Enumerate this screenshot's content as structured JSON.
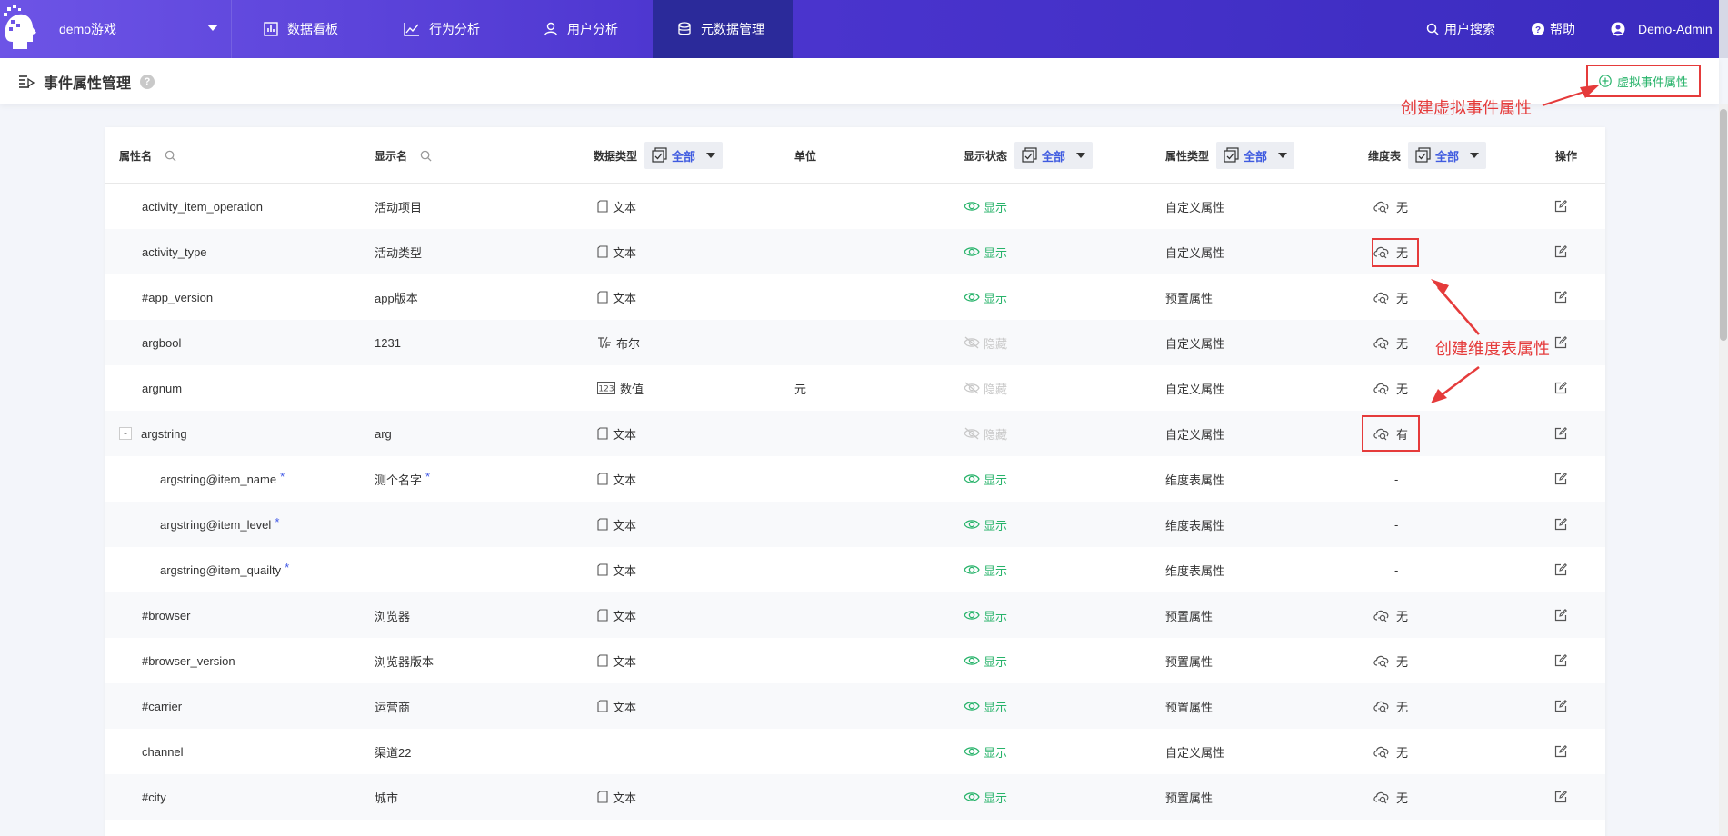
{
  "nav": {
    "game": "demo游戏",
    "items": [
      {
        "label": "数据看板",
        "icon": "bar-chart-icon"
      },
      {
        "label": "行为分析",
        "icon": "line-chart-icon"
      },
      {
        "label": "用户分析",
        "icon": "user-icon"
      },
      {
        "label": "元数据管理",
        "icon": "database-icon",
        "active": true
      }
    ],
    "user_search": "用户搜索",
    "help": "帮助",
    "account": "Demo-Admin"
  },
  "header": {
    "title": "事件属性管理",
    "help_mark": "?",
    "virtual_button": "虚拟事件属性"
  },
  "annotations": {
    "virtual": "创建虚拟事件属性",
    "dimension": "创建维度表属性"
  },
  "table": {
    "columns": {
      "name": "属性名",
      "display": "显示名",
      "data_type": "数据类型",
      "unit": "单位",
      "status": "显示状态",
      "attr_type": "属性类型",
      "dim": "维度表",
      "action": "操作",
      "filter_all": "全部"
    },
    "rows": [
      {
        "name": "activity_item_operation",
        "display": "活动项目",
        "type": "文本",
        "type_icon": "text",
        "unit": "",
        "status": "显示",
        "shown": true,
        "attr": "自定义属性",
        "dim": "无"
      },
      {
        "name": "activity_type",
        "display": "活动类型",
        "type": "文本",
        "type_icon": "text",
        "unit": "",
        "status": "显示",
        "shown": true,
        "attr": "自定义属性",
        "dim": "无"
      },
      {
        "name": "#app_version",
        "display": "app版本",
        "type": "文本",
        "type_icon": "text",
        "unit": "",
        "status": "显示",
        "shown": true,
        "attr": "预置属性",
        "dim": "无"
      },
      {
        "name": "argbool",
        "display": "1231",
        "type": "布尔",
        "type_icon": "bool",
        "unit": "",
        "status": "隐藏",
        "shown": false,
        "attr": "自定义属性",
        "dim": "无"
      },
      {
        "name": "argnum",
        "display": "",
        "type": "数值",
        "type_icon": "number",
        "unit": "元",
        "status": "隐藏",
        "shown": false,
        "attr": "自定义属性",
        "dim": "无"
      },
      {
        "name": "argstring",
        "display": "arg",
        "type": "文本",
        "type_icon": "text",
        "unit": "",
        "status": "隐藏",
        "shown": false,
        "attr": "自定义属性",
        "dim": "有",
        "expand": "-"
      },
      {
        "name": "argstring@item_name",
        "display": "测个名字",
        "type": "文本",
        "type_icon": "text",
        "unit": "",
        "status": "显示",
        "shown": true,
        "attr": "维度表属性",
        "dim": "-",
        "child": true,
        "req": "*",
        "display_req": "*"
      },
      {
        "name": "argstring@item_level",
        "display": "",
        "type": "文本",
        "type_icon": "text",
        "unit": "",
        "status": "显示",
        "shown": true,
        "attr": "维度表属性",
        "dim": "-",
        "child": true,
        "req": "*"
      },
      {
        "name": "argstring@item_quailty",
        "display": "",
        "type": "文本",
        "type_icon": "text",
        "unit": "",
        "status": "显示",
        "shown": true,
        "attr": "维度表属性",
        "dim": "-",
        "child": true,
        "req": "*"
      },
      {
        "name": "#browser",
        "display": "浏览器",
        "type": "文本",
        "type_icon": "text",
        "unit": "",
        "status": "显示",
        "shown": true,
        "attr": "预置属性",
        "dim": "无"
      },
      {
        "name": "#browser_version",
        "display": "浏览器版本",
        "type": "文本",
        "type_icon": "text",
        "unit": "",
        "status": "显示",
        "shown": true,
        "attr": "预置属性",
        "dim": "无"
      },
      {
        "name": "#carrier",
        "display": "运营商",
        "type": "文本",
        "type_icon": "text",
        "unit": "",
        "status": "显示",
        "shown": true,
        "attr": "预置属性",
        "dim": "无"
      },
      {
        "name": "channel",
        "display": "渠道22",
        "type": "",
        "type_icon": "",
        "unit": "",
        "status": "显示",
        "shown": true,
        "attr": "自定义属性",
        "dim": "无"
      },
      {
        "name": "#city",
        "display": "城市",
        "type": "文本",
        "type_icon": "text",
        "unit": "",
        "status": "显示",
        "shown": true,
        "attr": "预置属性",
        "dim": "无"
      }
    ]
  }
}
